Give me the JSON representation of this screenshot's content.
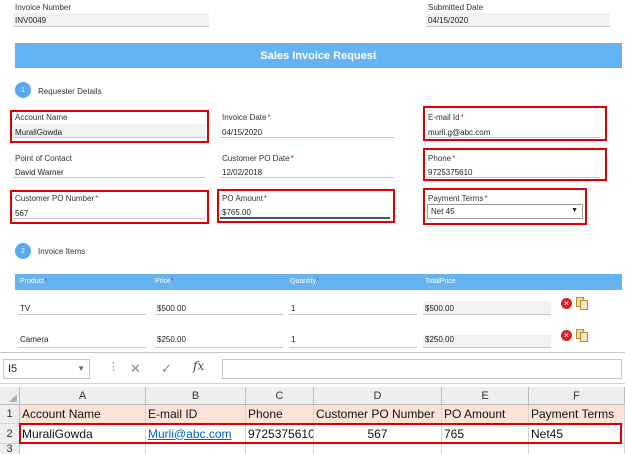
{
  "header": {
    "invoice_number_label": "Invoice Number",
    "invoice_number": "INV0049",
    "submitted_date_label": "Submitted Date",
    "submitted_date": "04/15/2020"
  },
  "title": "Sales Invoice Request",
  "requester": {
    "step": "1",
    "heading": "Requester Details",
    "account_name_label": "Account Name",
    "account_name": "MuraliGowda",
    "invoice_date_label": "Invoice Date",
    "invoice_date": "04/15/2020",
    "email_label": "E-mail Id",
    "email": "murli.g@abc.com",
    "contact_label": "Point of Contact",
    "contact": "David Warner",
    "customer_po_date_label": "Customer PO Date",
    "customer_po_date": "12/02/2018",
    "phone_label": "Phone",
    "phone": "9725375610",
    "customer_po_number_label": "Customer PO Number",
    "customer_po_number": "567",
    "po_amount_label": "PO Amount",
    "po_amount": "$765.00",
    "payment_terms_label": "Payment Terms",
    "payment_terms": "Net 45",
    "required_mark": "*"
  },
  "items": {
    "step": "2",
    "heading": "Invoice Items",
    "columns": [
      "Product",
      "Price",
      "Quantity",
      "TotalPrice"
    ],
    "rows": [
      {
        "product": "TV",
        "price": "$500.00",
        "quantity": "1",
        "total": "$500.00"
      },
      {
        "product": "Camera",
        "price": "$250.00",
        "quantity": "1",
        "total": "$250.00"
      }
    ]
  },
  "excel": {
    "name_box": "I5",
    "fx_label": "fx",
    "columns": [
      "A",
      "B",
      "C",
      "D",
      "E",
      "F"
    ],
    "rows": [
      "1",
      "2",
      "3"
    ],
    "headers": [
      "Account Name",
      "E-mail ID",
      "Phone",
      "Customer PO Number",
      "PO Amount",
      "Payment Terms"
    ],
    "values": [
      "MuraliGowda",
      "Murli@abc.com",
      "9725375610",
      "567",
      "765",
      "Net45"
    ]
  },
  "colors": {
    "accent": "#66b3f4",
    "highlight_border": "#e10000",
    "required": "#e02020",
    "excel_header_fill": "#fce4d6",
    "hyperlink": "#0563c1"
  },
  "icons": [
    "delete-icon",
    "copy-icon",
    "dropdown-arrow-icon",
    "cancel-icon",
    "enter-icon"
  ]
}
